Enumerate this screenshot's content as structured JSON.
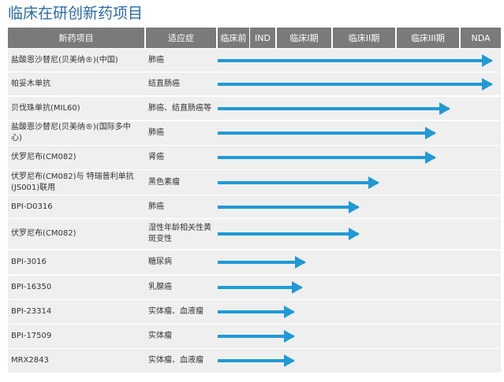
{
  "title": "临床在研创新药项目",
  "headers": [
    "新药项目",
    "适应症",
    "临床前",
    "IND",
    "临床I期",
    "临床II期",
    "临床III期",
    "NDA"
  ],
  "colors": {
    "header": "#7a7a7a",
    "arrow": "#1f9ad6",
    "row": "#efefef",
    "title": "#2a6aa8"
  },
  "rows": [
    {
      "drug": "盐酸恩沙替尼(贝美纳®)(中国)",
      "indication": "肺癌",
      "progress_pct": 100
    },
    {
      "drug": "帕妥木单抗",
      "indication": "结直肠癌",
      "progress_pct": 100
    },
    {
      "drug": "贝伐珠单抗(MIL60)",
      "indication": "肺癌、结直肠癌等",
      "progress_pct": 85
    },
    {
      "drug": "盐酸恩沙替尼(贝美纳®)(国际多中心)",
      "indication": "肺癌",
      "progress_pct": 80
    },
    {
      "drug": "伏罗尼布(CM082)",
      "indication": "肾癌",
      "progress_pct": 80
    },
    {
      "drug": "伏罗尼布(CM082)与 特瑞普利单抗(JS001)联用",
      "indication": "黑色素瘤",
      "progress_pct": 60
    },
    {
      "drug": "BPI-D0316",
      "indication": "肺癌",
      "progress_pct": 53
    },
    {
      "drug": "伏罗尼布(CM082)",
      "indication": "湿性年龄相关性黄斑变性",
      "progress_pct": 53
    },
    {
      "drug": "BPI-3016",
      "indication": "糖尿病",
      "progress_pct": 34
    },
    {
      "drug": "BPI-16350",
      "indication": "乳腺癌",
      "progress_pct": 33
    },
    {
      "drug": "BPI-23314",
      "indication": "实体瘤、血液瘤",
      "progress_pct": 30
    },
    {
      "drug": "BPI-17509",
      "indication": "实体瘤",
      "progress_pct": 30
    },
    {
      "drug": "MRX2843",
      "indication": "实体瘤、血液瘤",
      "progress_pct": 30
    }
  ]
}
